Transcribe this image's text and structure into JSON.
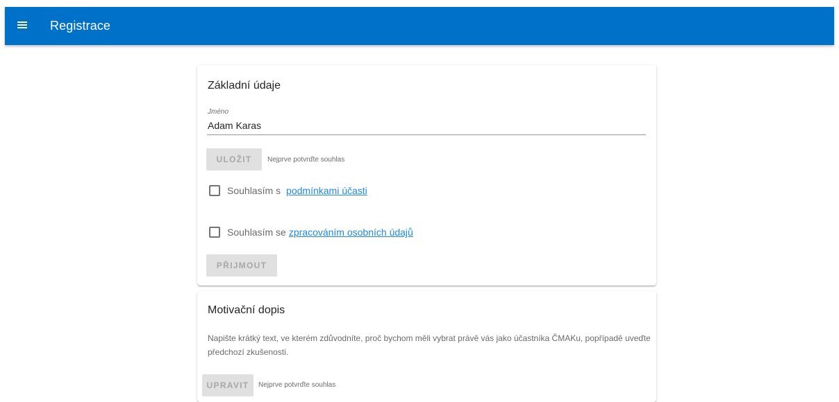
{
  "appbar": {
    "title": "Registrace",
    "menu_icon": "menu-icon",
    "color": "#0071c9"
  },
  "basic_info": {
    "title": "Základní údaje",
    "name_label": "Jméno",
    "name_value": "Adam Karas",
    "save_label": "ULOŽIT",
    "save_hint": "Nejprve potvrďte souhlas",
    "consent_terms_prefix": "Souhlasím s",
    "consent_terms_link": "podmínkami účasti",
    "consent_terms_checked": false,
    "consent_privacy_prefix": "Souhlasím se",
    "consent_privacy_link": "zpracováním osobních údajů",
    "consent_privacy_checked": false,
    "accept_label": "PŘIJMOUT"
  },
  "motivation": {
    "title": "Motivační dopis",
    "description": "Napište krátký text, ve kterém zdůvodníte, proč bychom měli vybrat právě vás jako účastníka ČMAKu, popřípadě uveďte předchozí zkušenosti.",
    "edit_label": "UPRAVIT",
    "edit_hint": "Nejprve potvrďte souhlas"
  },
  "colors": {
    "link": "#1e88e5",
    "disabled_button_bg": "#e0e0e0"
  }
}
